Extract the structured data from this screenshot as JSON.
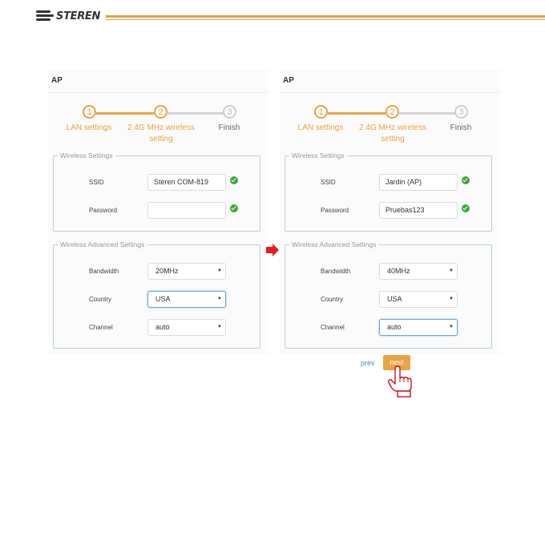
{
  "brand": {
    "name": "STEREN",
    "accent": "#e0a24a"
  },
  "panels": [
    {
      "title": "AP",
      "steps": [
        {
          "num": "1",
          "label": "LAN settings",
          "state": "active"
        },
        {
          "num": "2",
          "label": "2.4G MHz wireless setting",
          "state": "active"
        },
        {
          "num": "3",
          "label": "Finish",
          "state": "inactive"
        }
      ],
      "wireless": {
        "legend": "Wireless Settings",
        "ssid_label": "SSID",
        "ssid_value": "Steren COM-819",
        "password_label": "Password",
        "password_value": ""
      },
      "advanced": {
        "legend": "Wireless Advanced Settings",
        "bandwidth_label": "Bandwidth",
        "bandwidth_value": "20MHz",
        "country_label": "Country",
        "country_value": "USA",
        "channel_label": "Channel",
        "channel_value": "auto"
      }
    },
    {
      "title": "AP",
      "steps": [
        {
          "num": "1",
          "label": "LAN settings",
          "state": "active"
        },
        {
          "num": "2",
          "label": "2.4G MHz wireless setting",
          "state": "active"
        },
        {
          "num": "3",
          "label": "Finish",
          "state": "inactive"
        }
      ],
      "wireless": {
        "legend": "Wireless Settings",
        "ssid_label": "SSID",
        "ssid_value": "Jardin (AP)",
        "password_label": "Password",
        "password_value": "Pruebas123"
      },
      "advanced": {
        "legend": "Wireless Advanced Settings",
        "bandwidth_label": "Bandwidth",
        "bandwidth_value": "40MHz",
        "country_label": "Country",
        "country_value": "USA",
        "channel_label": "Channel",
        "channel_value": "auto"
      }
    }
  ],
  "nav": {
    "prev_label": "prev",
    "next_label": "next"
  },
  "icons": {
    "arrow": "red-arrow-right-icon",
    "hand": "pointing-hand-icon",
    "check": "check-circle-icon"
  },
  "colors": {
    "step_active": "#e9a444",
    "step_inactive": "#cccccc",
    "check": "#3da83d",
    "next_button": "#e9a444",
    "arrow": "#e31e24"
  }
}
